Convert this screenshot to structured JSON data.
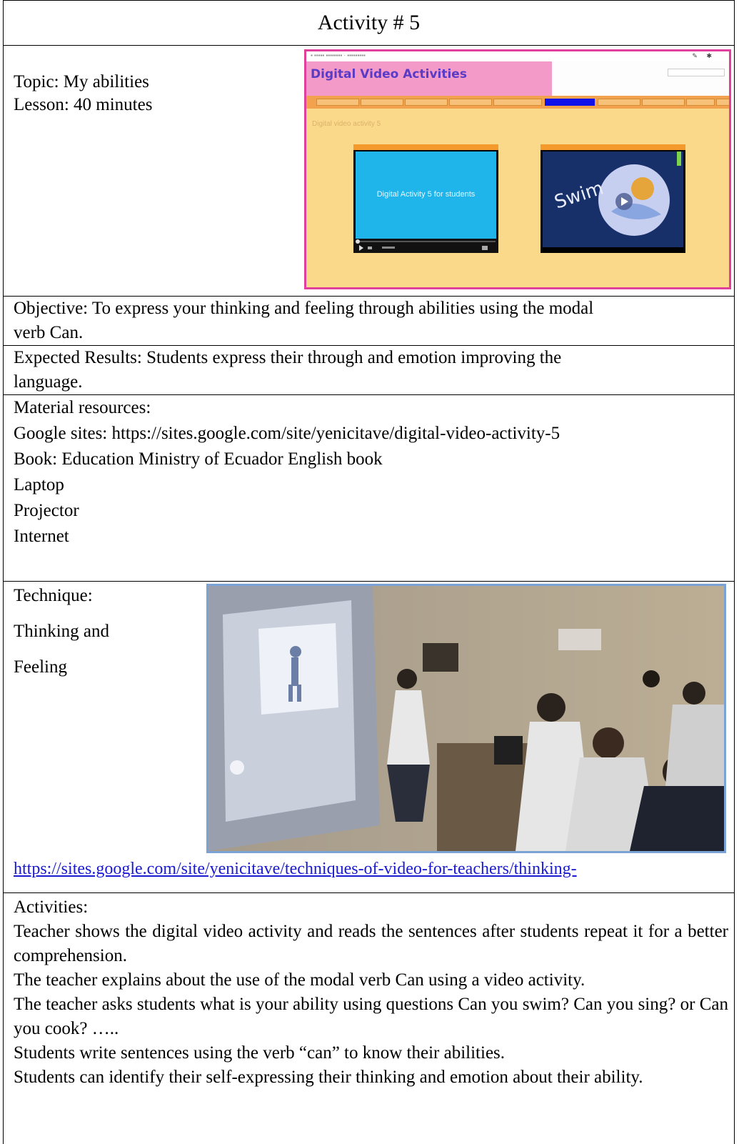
{
  "title": "Activity # 5",
  "topic": "Topic: My abilities",
  "lesson": "Lesson: 40 minutes",
  "site_screenshot": {
    "header_title": "Digital Video Activities",
    "page_heading": "Digital video activity 5",
    "video_1_text": "Digital Activity 5 for students",
    "video_2_text": "Swim"
  },
  "objective": {
    "line1": "Objective: To express your thinking and feeling through abilities using the modal",
    "line2": "verb Can."
  },
  "expected_results": {
    "line1": "Expected Results: Students express their through and emotion improving the",
    "line2": "language."
  },
  "materials": {
    "label": "Material resources:",
    "items": [
      "Google sites: https://sites.google.com/site/yenicitave/digital-video-activity-5",
      "Book: Education Ministry of Ecuador English book",
      "Laptop",
      "Projector",
      "Internet"
    ]
  },
  "technique": {
    "label": "Technique:",
    "line1": "Thinking and",
    "line2": "Feeling",
    "link": "https://sites.google.com/site/yenicitave/techniques-of-video-for-teachers/thinking-"
  },
  "activities": {
    "label": "Activities:",
    "paragraphs": [
      "Teacher shows the digital video activity and reads the sentences after students repeat it for a better comprehension.",
      "The teacher explains about the use of the modal verb Can using a video activity.",
      "The teacher asks students what is your ability using questions Can you swim? Can you sing? or Can you cook? …..",
      "Students write sentences using the verb “can” to know their abilities.",
      "Students can identify their self-expressing their thinking and emotion about their ability."
    ]
  }
}
